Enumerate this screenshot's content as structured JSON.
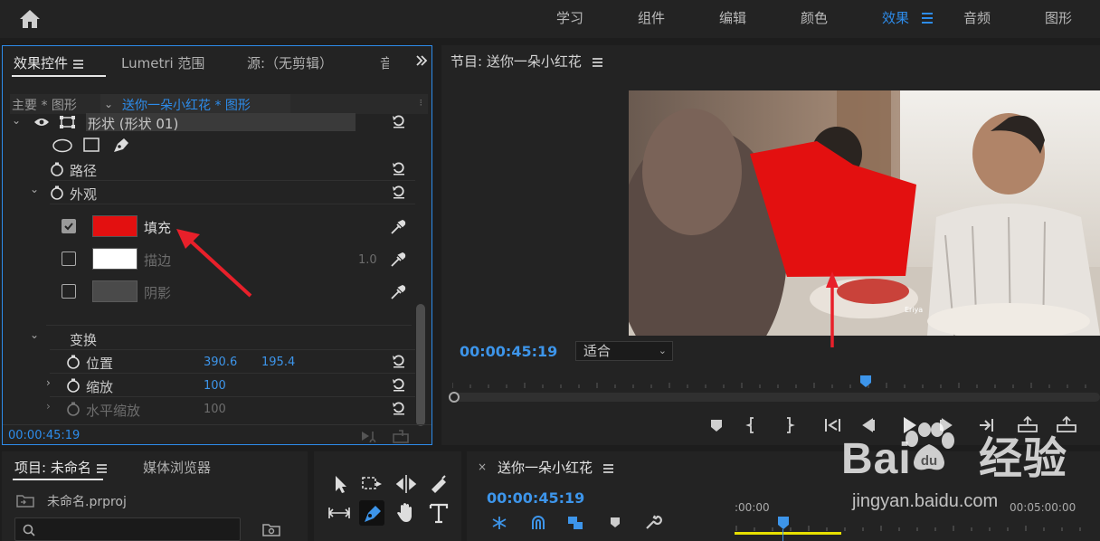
{
  "workspace": {
    "tabs": [
      "学习",
      "组件",
      "编辑",
      "颜色",
      "效果",
      "音频",
      "图形"
    ],
    "active_tab": "效果"
  },
  "effect_controls": {
    "tabs": [
      "效果控件",
      "Lumetri 范围",
      "源:（无剪辑）"
    ],
    "source_master": "主要 * 图形",
    "source_clip": "送你一朵小红花 * 图形",
    "shape_layer": "形状 (形状 01)",
    "path_label": "路径",
    "appearance_label": "外观",
    "fill": {
      "label": "填充",
      "checked": true,
      "color": "#e31010"
    },
    "stroke": {
      "label": "描边",
      "checked": false,
      "color": "#ffffff",
      "width": "1.0"
    },
    "shadow": {
      "label": "阴影",
      "checked": false,
      "color": "#4a4a4a"
    },
    "transform_label": "变换",
    "position": {
      "label": "位置",
      "x": "390.6",
      "y": "195.4"
    },
    "scale": {
      "label": "缩放",
      "value": "100"
    },
    "scale_h": {
      "label": "水平缩放",
      "value": "100"
    },
    "timecode": "00:00:45:19"
  },
  "program": {
    "title": "节目: 送你一朵小红花",
    "timecode": "00:00:45:19",
    "fit": "适合",
    "subtitle_text": "Eriya"
  },
  "project": {
    "tabs": [
      "项目: 未命名",
      "媒体浏览器"
    ],
    "file": "未命名.prproj"
  },
  "timeline": {
    "sequence": "送你一朵小红花",
    "timecode": "00:00:45:19",
    "ruler_start": ":00:00",
    "ruler_end": "00:05:00:00"
  },
  "watermark": {
    "brand": "Bai 经验",
    "url": "jingyan.baidu.com"
  },
  "colors": {
    "accent": "#2d8ceb",
    "fill_red": "#e31010",
    "work_area": "#e8e000"
  }
}
